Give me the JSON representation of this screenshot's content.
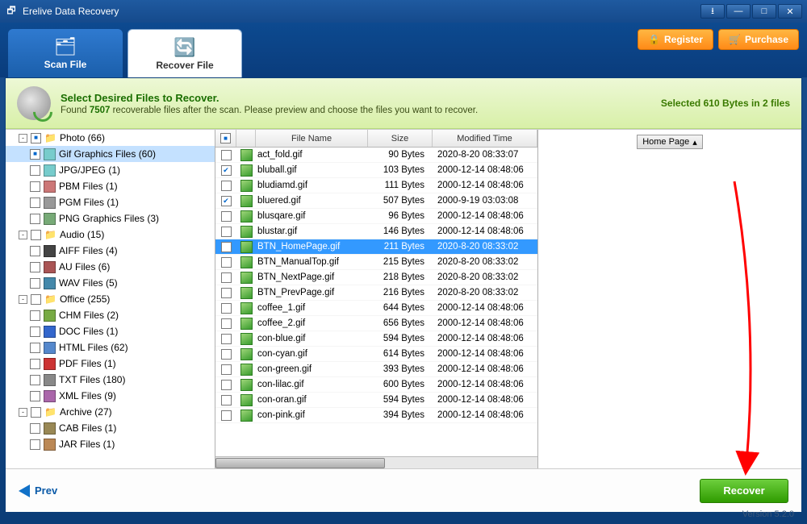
{
  "window": {
    "title": "Erelive Data Recovery"
  },
  "header": {
    "tabs": {
      "scan": "Scan File",
      "recover": "Recover File"
    },
    "buttons": {
      "register": "Register",
      "purchase": "Purchase"
    }
  },
  "banner": {
    "title": "Select Desired Files to Recover.",
    "prefix": "Found ",
    "count": "7507",
    "suffix": " recoverable files after the scan. Please preview and choose the files you want to recover.",
    "selected": "Selected 610 Bytes in 2 files"
  },
  "sidebar": [
    {
      "exp": "-",
      "chk": "partial",
      "icon": "📁",
      "label": "Photo (66)",
      "depth": 1
    },
    {
      "exp": "",
      "chk": "partial",
      "icon": "img",
      "label": "Gif Graphics Files (60)",
      "depth": 2,
      "selected": true
    },
    {
      "exp": "",
      "chk": "",
      "icon": "img",
      "label": "JPG/JPEG (1)",
      "depth": 2
    },
    {
      "exp": "",
      "chk": "",
      "icon": "pbm",
      "label": "PBM Files (1)",
      "depth": 2
    },
    {
      "exp": "",
      "chk": "",
      "icon": "sony",
      "label": "PGM Files (1)",
      "depth": 2
    },
    {
      "exp": "",
      "chk": "",
      "icon": "png",
      "label": "PNG Graphics Files (3)",
      "depth": 2
    },
    {
      "exp": "-",
      "chk": "",
      "icon": "📁",
      "label": "Audio (15)",
      "depth": 1
    },
    {
      "exp": "",
      "chk": "",
      "icon": "aiff",
      "label": "AIFF Files (4)",
      "depth": 2
    },
    {
      "exp": "",
      "chk": "",
      "icon": "au",
      "label": "AU Files (6)",
      "depth": 2
    },
    {
      "exp": "",
      "chk": "",
      "icon": "wav",
      "label": "WAV Files (5)",
      "depth": 2
    },
    {
      "exp": "-",
      "chk": "",
      "icon": "📁",
      "label": "Office (255)",
      "depth": 1
    },
    {
      "exp": "",
      "chk": "",
      "icon": "chm",
      "label": "CHM Files (2)",
      "depth": 2
    },
    {
      "exp": "",
      "chk": "",
      "icon": "doc",
      "label": "DOC Files (1)",
      "depth": 2
    },
    {
      "exp": "",
      "chk": "",
      "icon": "html",
      "label": "HTML Files (62)",
      "depth": 2
    },
    {
      "exp": "",
      "chk": "",
      "icon": "pdf",
      "label": "PDF Files (1)",
      "depth": 2
    },
    {
      "exp": "",
      "chk": "",
      "icon": "txt",
      "label": "TXT Files (180)",
      "depth": 2
    },
    {
      "exp": "",
      "chk": "",
      "icon": "xml",
      "label": "XML Files (9)",
      "depth": 2
    },
    {
      "exp": "-",
      "chk": "",
      "icon": "📁",
      "label": "Archive (27)",
      "depth": 1
    },
    {
      "exp": "",
      "chk": "",
      "icon": "cab",
      "label": "CAB Files (1)",
      "depth": 2
    },
    {
      "exp": "",
      "chk": "",
      "icon": "jar",
      "label": "JAR Files (1)",
      "depth": 2
    }
  ],
  "filelist": {
    "headers": {
      "name": "File Name",
      "size": "Size",
      "time": "Modified Time"
    },
    "rows": [
      {
        "chk": "",
        "name": "act_fold.gif",
        "size": "90 Bytes",
        "time": "2020-8-20 08:33:07"
      },
      {
        "chk": "checked",
        "name": "bluball.gif",
        "size": "103 Bytes",
        "time": "2000-12-14 08:48:06"
      },
      {
        "chk": "",
        "name": "bludiamd.gif",
        "size": "111 Bytes",
        "time": "2000-12-14 08:48:06"
      },
      {
        "chk": "checked",
        "name": "bluered.gif",
        "size": "507 Bytes",
        "time": "2000-9-19 03:03:08"
      },
      {
        "chk": "",
        "name": "blusqare.gif",
        "size": "96 Bytes",
        "time": "2000-12-14 08:48:06"
      },
      {
        "chk": "",
        "name": "blustar.gif",
        "size": "146 Bytes",
        "time": "2000-12-14 08:48:06"
      },
      {
        "chk": "",
        "name": "BTN_HomePage.gif",
        "size": "211 Bytes",
        "time": "2020-8-20 08:33:02",
        "selected": true
      },
      {
        "chk": "",
        "name": "BTN_ManualTop.gif",
        "size": "215 Bytes",
        "time": "2020-8-20 08:33:02"
      },
      {
        "chk": "",
        "name": "BTN_NextPage.gif",
        "size": "218 Bytes",
        "time": "2020-8-20 08:33:02"
      },
      {
        "chk": "",
        "name": "BTN_PrevPage.gif",
        "size": "216 Bytes",
        "time": "2020-8-20 08:33:02"
      },
      {
        "chk": "",
        "name": "coffee_1.gif",
        "size": "644 Bytes",
        "time": "2000-12-14 08:48:06"
      },
      {
        "chk": "",
        "name": "coffee_2.gif",
        "size": "656 Bytes",
        "time": "2000-12-14 08:48:06"
      },
      {
        "chk": "",
        "name": "con-blue.gif",
        "size": "594 Bytes",
        "time": "2000-12-14 08:48:06"
      },
      {
        "chk": "",
        "name": "con-cyan.gif",
        "size": "614 Bytes",
        "time": "2000-12-14 08:48:06"
      },
      {
        "chk": "",
        "name": "con-green.gif",
        "size": "393 Bytes",
        "time": "2000-12-14 08:48:06"
      },
      {
        "chk": "",
        "name": "con-lilac.gif",
        "size": "600 Bytes",
        "time": "2000-12-14 08:48:06"
      },
      {
        "chk": "",
        "name": "con-oran.gif",
        "size": "594 Bytes",
        "time": "2000-12-14 08:48:06"
      },
      {
        "chk": "",
        "name": "con-pink.gif",
        "size": "394 Bytes",
        "time": "2000-12-14 08:48:06"
      }
    ]
  },
  "preview": {
    "button": "Home Page"
  },
  "footer": {
    "prev": "Prev",
    "recover": "Recover",
    "version": "Version 5.2.0"
  }
}
